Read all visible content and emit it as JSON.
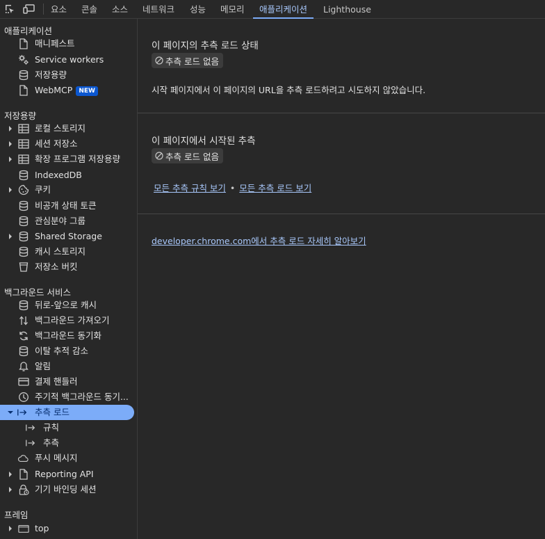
{
  "toolbar": {
    "tabs": [
      {
        "label": "요소"
      },
      {
        "label": "콘솔"
      },
      {
        "label": "소스"
      },
      {
        "label": "네트워크"
      },
      {
        "label": "성능"
      },
      {
        "label": "메모리"
      },
      {
        "label": "애플리케이션"
      },
      {
        "label": "Lighthouse"
      }
    ],
    "active_tab": "애플리케이션"
  },
  "sidebar": {
    "sections": [
      {
        "title": "애플리케이션"
      },
      {
        "title": "저장용량"
      },
      {
        "title": "백그라운드 서비스"
      },
      {
        "title": "프레임"
      }
    ],
    "app_items": [
      {
        "label": "매니페스트",
        "icon": "file-icon"
      },
      {
        "label": "Service workers",
        "icon": "gears-icon"
      },
      {
        "label": "저장용량",
        "icon": "database-icon"
      },
      {
        "label": "WebMCP",
        "icon": "file-icon",
        "badge": "NEW"
      }
    ],
    "storage_items": [
      {
        "label": "로컬 스토리지",
        "icon": "table-icon",
        "expandable": true
      },
      {
        "label": "세션 저장소",
        "icon": "table-icon",
        "expandable": true
      },
      {
        "label": "확장 프로그램 저장용량",
        "icon": "table-icon",
        "expandable": true
      },
      {
        "label": "IndexedDB",
        "icon": "database-icon"
      },
      {
        "label": "쿠키",
        "icon": "cookie-icon",
        "expandable": true
      },
      {
        "label": "비공개 상태 토큰",
        "icon": "database-icon"
      },
      {
        "label": "관심분야 그룹",
        "icon": "database-icon"
      },
      {
        "label": "Shared Storage",
        "icon": "database-icon",
        "expandable": true
      },
      {
        "label": "캐시 스토리지",
        "icon": "database-icon"
      },
      {
        "label": "저장소 버킷",
        "icon": "bucket-icon"
      }
    ],
    "background_items": [
      {
        "label": "뒤로-앞으로 캐시",
        "icon": "database-icon"
      },
      {
        "label": "백그라운드 가져오기",
        "icon": "updown-arrows-icon"
      },
      {
        "label": "백그라운드 동기화",
        "icon": "sync-icon"
      },
      {
        "label": "이탈 추적 감소",
        "icon": "database-icon"
      },
      {
        "label": "알림",
        "icon": "bell-icon"
      },
      {
        "label": "결제 핸들러",
        "icon": "card-icon"
      },
      {
        "label": "주기적 백그라운드 동기...",
        "icon": "clock-icon"
      },
      {
        "label": "추측 로드",
        "icon": "arrow-bar-icon",
        "expanded": true,
        "selected": true
      },
      {
        "label": "규칙",
        "icon": "arrow-bar-icon",
        "child": true
      },
      {
        "label": "추측",
        "icon": "arrow-bar-icon",
        "child": true
      },
      {
        "label": "푸시 메시지",
        "icon": "cloud-icon"
      },
      {
        "label": "Reporting API",
        "icon": "file-icon",
        "expandable": true
      },
      {
        "label": "기기 바인딩 세션",
        "icon": "lock-icon",
        "expandable": true
      }
    ],
    "frame_items": [
      {
        "label": "top",
        "icon": "frame-icon",
        "expandable": true
      }
    ]
  },
  "main": {
    "status_section": {
      "title": "이 페이지의 추측 로드 상태",
      "chip": "추측 로드 없음",
      "description": "시작 페이지에서 이 페이지의 URL을 추측 로드하려고 시도하지 않았습니다."
    },
    "initiated_section": {
      "title": "이 페이지에서 시작된 추측",
      "chip": "추측 로드 없음",
      "link_rules": "모든 추측 규칙 보기",
      "separator": "•",
      "link_all": "모든 추측 로드 보기"
    },
    "learn_more": "developer.chrome.com에서 추측 로드 자세히 알아보기"
  },
  "colors": {
    "background": "#282828",
    "accent": "#7cacf8",
    "link": "#a8c7fa",
    "badge": "#0b57d0"
  }
}
